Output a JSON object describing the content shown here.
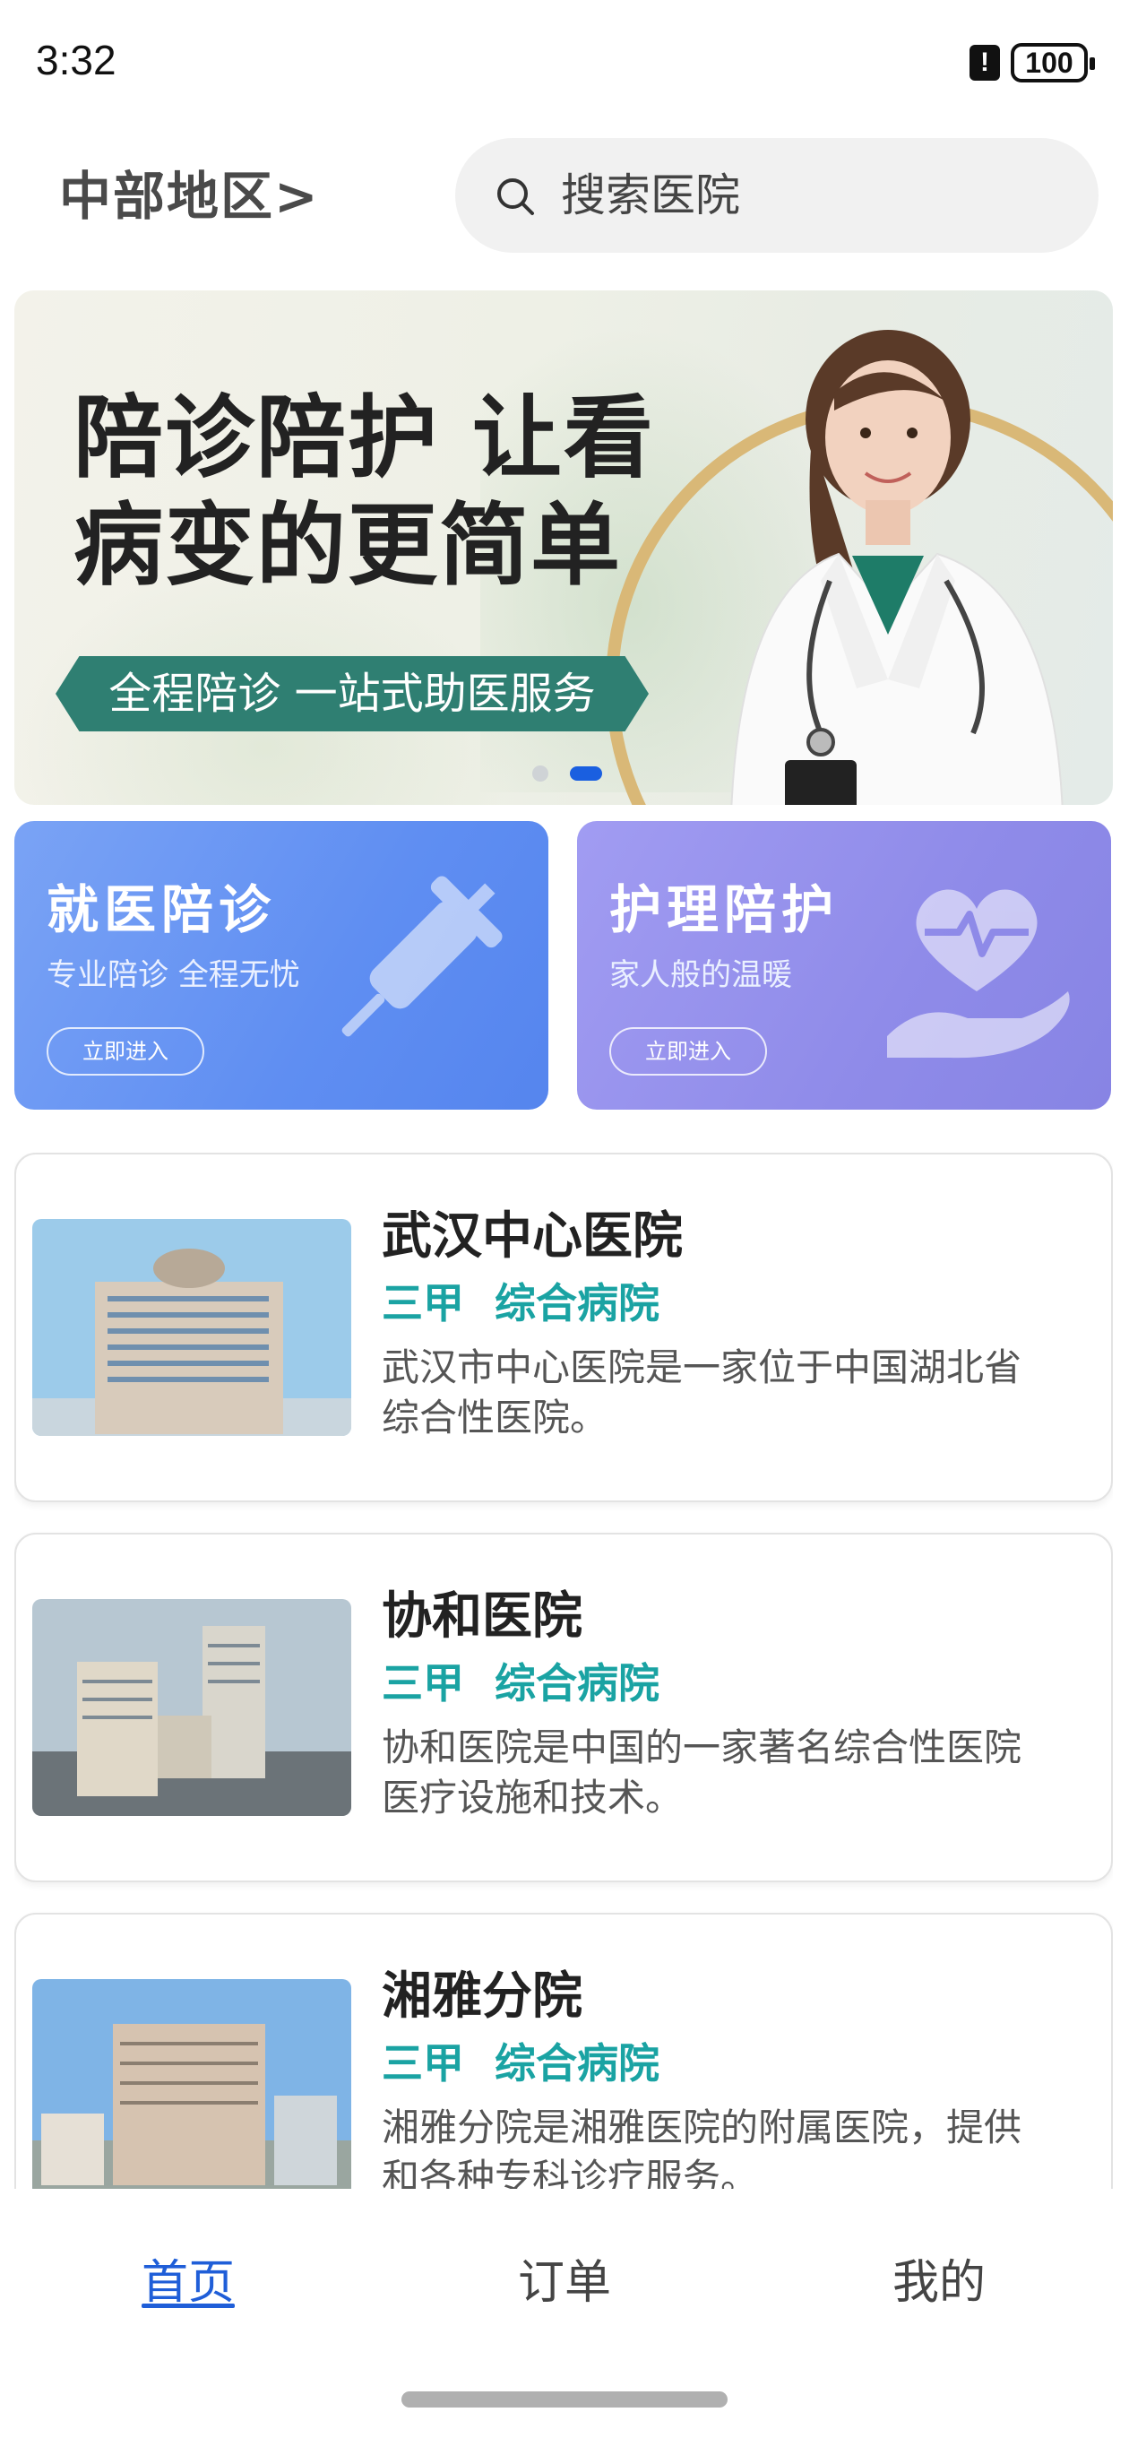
{
  "status_bar": {
    "time": "3:32",
    "alert_icon": "!",
    "battery": "100"
  },
  "header": {
    "region": "中部地区>",
    "search_placeholder": "搜索医院"
  },
  "banner": {
    "title_line1": "陪诊陪护 让看",
    "title_line2": "病变的更简单",
    "subtitle": "全程陪诊 一站式助医服务",
    "page_count": 2,
    "active_page": 2
  },
  "services": [
    {
      "title": "就医陪诊",
      "desc": "专业陪诊 全程无忧",
      "button": "立即进入",
      "icon": "syringe-icon"
    },
    {
      "title": "护理陪护",
      "desc": "家人般的温暖",
      "button": "立即进入",
      "icon": "heart-hand-icon"
    }
  ],
  "hospitals": [
    {
      "name": "武汉中心医院",
      "level": "三甲",
      "type": "综合病院",
      "desc_line1": "武汉市中心医院是一家位于中国湖北省",
      "desc_line2": "综合性医院。"
    },
    {
      "name": "协和医院",
      "level": "三甲",
      "type": "综合病院",
      "desc_line1": "协和医院是中国的一家著名综合性医院",
      "desc_line2": "医疗设施和技术。"
    },
    {
      "name": "湘雅分院",
      "level": "三甲",
      "type": "综合病院",
      "desc_line1": "湘雅分院是湘雅医院的附属医院，提供",
      "desc_line2": "和各种专科诊疗服务。"
    }
  ],
  "tabs": [
    {
      "label": "首页",
      "active": true
    },
    {
      "label": "订单",
      "active": false
    },
    {
      "label": "我的",
      "active": false
    }
  ],
  "colors": {
    "accent": "#1f5ed8",
    "tag": "#1aa3a3",
    "card_left": "#5f8ef2",
    "card_right": "#8f8be9"
  }
}
